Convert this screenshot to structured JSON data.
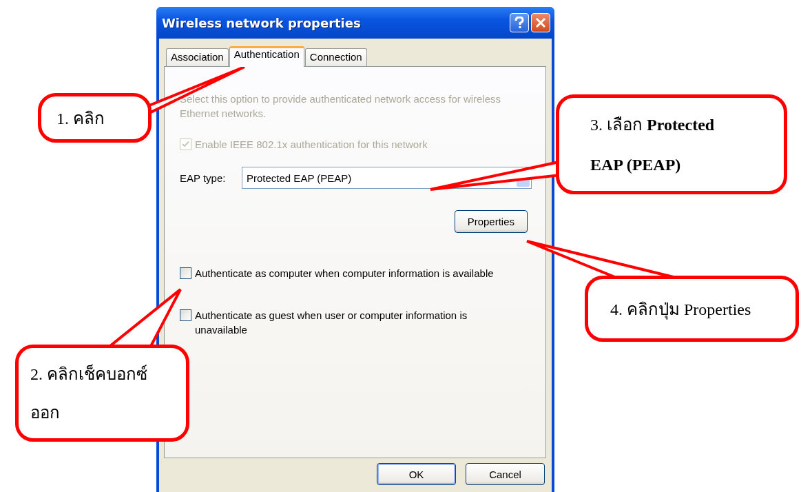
{
  "window": {
    "title": "Wireless network properties"
  },
  "tabs": [
    {
      "label": "Association",
      "selected": false
    },
    {
      "label": "Authentication",
      "selected": true
    },
    {
      "label": "Connection",
      "selected": false
    }
  ],
  "description": {
    "text": "Select this option to provide authenticated network access for wireless Ethernet networks.",
    "disabled": true
  },
  "options": [
    {
      "kind": "checkbox",
      "label": "Enable IEEE 802.1x authentication for this network",
      "checked": true,
      "disabled": true
    },
    {
      "kind": "dropdown",
      "label": "EAP type:",
      "value": "Protected EAP (PEAP)"
    },
    {
      "kind": "button",
      "label": "Properties"
    },
    {
      "kind": "checkbox",
      "label": "Authenticate as computer when computer information is available",
      "checked": false,
      "disabled": false
    },
    {
      "kind": "checkbox",
      "label": "Authenticate as guest when user or computer information is unavailable",
      "checked": false,
      "disabled": false
    }
  ],
  "buttons": [
    "OK",
    "Cancel"
  ],
  "callouts": [
    {
      "text": "1. คลิก"
    },
    {
      "text": "2. คลิกเช็คบอกซ์ ออก"
    },
    {
      "text": "3. เลือก **Protected EAP (PEAP)**"
    },
    {
      "text": "4. คลิกปุ่ม Properties"
    }
  ]
}
